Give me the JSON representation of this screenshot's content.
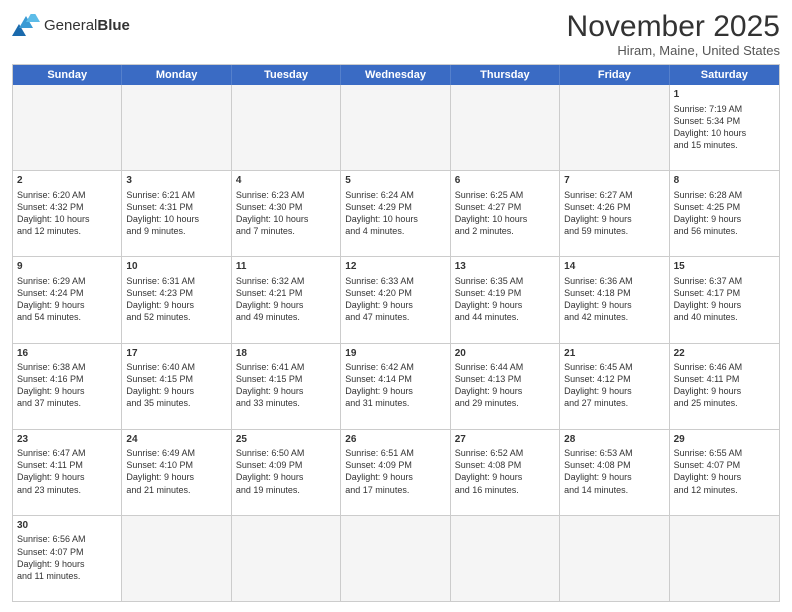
{
  "header": {
    "logo_text_regular": "General",
    "logo_text_bold": "Blue",
    "month": "November 2025",
    "location": "Hiram, Maine, United States"
  },
  "days_of_week": [
    "Sunday",
    "Monday",
    "Tuesday",
    "Wednesday",
    "Thursday",
    "Friday",
    "Saturday"
  ],
  "rows": [
    [
      {
        "day": "",
        "info": ""
      },
      {
        "day": "",
        "info": ""
      },
      {
        "day": "",
        "info": ""
      },
      {
        "day": "",
        "info": ""
      },
      {
        "day": "",
        "info": ""
      },
      {
        "day": "",
        "info": ""
      },
      {
        "day": "1",
        "info": "Sunrise: 7:19 AM\nSunset: 5:34 PM\nDaylight: 10 hours\nand 15 minutes."
      }
    ],
    [
      {
        "day": "2",
        "info": "Sunrise: 6:20 AM\nSunset: 4:32 PM\nDaylight: 10 hours\nand 12 minutes."
      },
      {
        "day": "3",
        "info": "Sunrise: 6:21 AM\nSunset: 4:31 PM\nDaylight: 10 hours\nand 9 minutes."
      },
      {
        "day": "4",
        "info": "Sunrise: 6:23 AM\nSunset: 4:30 PM\nDaylight: 10 hours\nand 7 minutes."
      },
      {
        "day": "5",
        "info": "Sunrise: 6:24 AM\nSunset: 4:29 PM\nDaylight: 10 hours\nand 4 minutes."
      },
      {
        "day": "6",
        "info": "Sunrise: 6:25 AM\nSunset: 4:27 PM\nDaylight: 10 hours\nand 2 minutes."
      },
      {
        "day": "7",
        "info": "Sunrise: 6:27 AM\nSunset: 4:26 PM\nDaylight: 9 hours\nand 59 minutes."
      },
      {
        "day": "8",
        "info": "Sunrise: 6:28 AM\nSunset: 4:25 PM\nDaylight: 9 hours\nand 56 minutes."
      }
    ],
    [
      {
        "day": "9",
        "info": "Sunrise: 6:29 AM\nSunset: 4:24 PM\nDaylight: 9 hours\nand 54 minutes."
      },
      {
        "day": "10",
        "info": "Sunrise: 6:31 AM\nSunset: 4:23 PM\nDaylight: 9 hours\nand 52 minutes."
      },
      {
        "day": "11",
        "info": "Sunrise: 6:32 AM\nSunset: 4:21 PM\nDaylight: 9 hours\nand 49 minutes."
      },
      {
        "day": "12",
        "info": "Sunrise: 6:33 AM\nSunset: 4:20 PM\nDaylight: 9 hours\nand 47 minutes."
      },
      {
        "day": "13",
        "info": "Sunrise: 6:35 AM\nSunset: 4:19 PM\nDaylight: 9 hours\nand 44 minutes."
      },
      {
        "day": "14",
        "info": "Sunrise: 6:36 AM\nSunset: 4:18 PM\nDaylight: 9 hours\nand 42 minutes."
      },
      {
        "day": "15",
        "info": "Sunrise: 6:37 AM\nSunset: 4:17 PM\nDaylight: 9 hours\nand 40 minutes."
      }
    ],
    [
      {
        "day": "16",
        "info": "Sunrise: 6:38 AM\nSunset: 4:16 PM\nDaylight: 9 hours\nand 37 minutes."
      },
      {
        "day": "17",
        "info": "Sunrise: 6:40 AM\nSunset: 4:15 PM\nDaylight: 9 hours\nand 35 minutes."
      },
      {
        "day": "18",
        "info": "Sunrise: 6:41 AM\nSunset: 4:15 PM\nDaylight: 9 hours\nand 33 minutes."
      },
      {
        "day": "19",
        "info": "Sunrise: 6:42 AM\nSunset: 4:14 PM\nDaylight: 9 hours\nand 31 minutes."
      },
      {
        "day": "20",
        "info": "Sunrise: 6:44 AM\nSunset: 4:13 PM\nDaylight: 9 hours\nand 29 minutes."
      },
      {
        "day": "21",
        "info": "Sunrise: 6:45 AM\nSunset: 4:12 PM\nDaylight: 9 hours\nand 27 minutes."
      },
      {
        "day": "22",
        "info": "Sunrise: 6:46 AM\nSunset: 4:11 PM\nDaylight: 9 hours\nand 25 minutes."
      }
    ],
    [
      {
        "day": "23",
        "info": "Sunrise: 6:47 AM\nSunset: 4:11 PM\nDaylight: 9 hours\nand 23 minutes."
      },
      {
        "day": "24",
        "info": "Sunrise: 6:49 AM\nSunset: 4:10 PM\nDaylight: 9 hours\nand 21 minutes."
      },
      {
        "day": "25",
        "info": "Sunrise: 6:50 AM\nSunset: 4:09 PM\nDaylight: 9 hours\nand 19 minutes."
      },
      {
        "day": "26",
        "info": "Sunrise: 6:51 AM\nSunset: 4:09 PM\nDaylight: 9 hours\nand 17 minutes."
      },
      {
        "day": "27",
        "info": "Sunrise: 6:52 AM\nSunset: 4:08 PM\nDaylight: 9 hours\nand 16 minutes."
      },
      {
        "day": "28",
        "info": "Sunrise: 6:53 AM\nSunset: 4:08 PM\nDaylight: 9 hours\nand 14 minutes."
      },
      {
        "day": "29",
        "info": "Sunrise: 6:55 AM\nSunset: 4:07 PM\nDaylight: 9 hours\nand 12 minutes."
      }
    ],
    [
      {
        "day": "30",
        "info": "Sunrise: 6:56 AM\nSunset: 4:07 PM\nDaylight: 9 hours\nand 11 minutes."
      },
      {
        "day": "",
        "info": ""
      },
      {
        "day": "",
        "info": ""
      },
      {
        "day": "",
        "info": ""
      },
      {
        "day": "",
        "info": ""
      },
      {
        "day": "",
        "info": ""
      },
      {
        "day": "",
        "info": ""
      }
    ]
  ]
}
